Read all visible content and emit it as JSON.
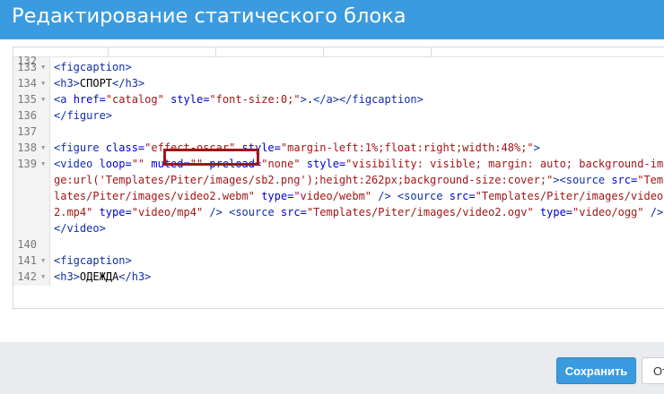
{
  "dialog": {
    "title": "Редактирование статического блока"
  },
  "editor": {
    "lines": [
      {
        "num": "133",
        "fold": true,
        "parts": [
          [
            "t",
            "<figcaption>"
          ]
        ]
      },
      {
        "num": "134",
        "fold": true,
        "parts": [
          [
            "t",
            "<h3>"
          ],
          [
            "x",
            "СПОРТ"
          ],
          [
            "t",
            "</h3>"
          ]
        ]
      },
      {
        "num": "135",
        "fold": true,
        "parts": [
          [
            "t",
            "<a "
          ],
          [
            "a",
            "href="
          ],
          [
            "s",
            "\"catalog\""
          ],
          [
            "a",
            " style="
          ],
          [
            "s",
            "\"font-size:0;\""
          ],
          [
            "t",
            ">"
          ],
          [
            "x",
            "."
          ],
          [
            "t",
            "</a></figcaption>"
          ]
        ]
      },
      {
        "num": "136",
        "fold": false,
        "parts": [
          [
            "t",
            "</figure>"
          ]
        ]
      },
      {
        "num": "137",
        "fold": false,
        "parts": []
      },
      {
        "num": "138",
        "fold": true,
        "parts": [
          [
            "t",
            "<figure "
          ],
          [
            "a",
            "class="
          ],
          [
            "s",
            "\"effect-oscar\""
          ],
          [
            "a",
            " style="
          ],
          [
            "s",
            "\"margin-left:1%;float:right;width:48%;\""
          ],
          [
            "t",
            ">"
          ]
        ]
      },
      {
        "num": "139",
        "fold": true,
        "parts": [
          [
            "t",
            "<video "
          ],
          [
            "a",
            "loop="
          ],
          [
            "s",
            "\"\""
          ],
          [
            "a",
            " muted="
          ],
          [
            "s",
            "\"\""
          ],
          [
            "x",
            " "
          ],
          [
            "a",
            "preload="
          ],
          [
            "s",
            "\"none\""
          ],
          [
            "a",
            " style="
          ],
          [
            "s",
            "\"visibility: visible; margin: auto; background-ima"
          ]
        ]
      },
      {
        "num": "",
        "fold": false,
        "parts": [
          [
            "s",
            "ge:url('Templates/Piter/images/sb2.png');height:262px;background-size:cover;\""
          ],
          [
            "t",
            "><source "
          ],
          [
            "a",
            "src="
          ],
          [
            "s",
            "\"Templ"
          ]
        ]
      },
      {
        "num": "",
        "fold": false,
        "parts": [
          [
            "s",
            "lates/Piter/images/video2.webm\""
          ],
          [
            "a",
            " type="
          ],
          [
            "s",
            "\"video/webm\""
          ],
          [
            "t",
            " /> <source "
          ],
          [
            "a",
            "src="
          ],
          [
            "s",
            "\"Templates/Piter/images/video"
          ]
        ]
      },
      {
        "num": "",
        "fold": false,
        "parts": [
          [
            "s",
            "2.mp4\""
          ],
          [
            "a",
            " type="
          ],
          [
            "s",
            "\"video/mp4\""
          ],
          [
            "t",
            " /> <source "
          ],
          [
            "a",
            "src="
          ],
          [
            "s",
            "\"Templates/Piter/images/video2.ogv\""
          ],
          [
            "a",
            " type="
          ],
          [
            "s",
            "\"video/ogg\""
          ],
          [
            "t",
            " />"
          ]
        ]
      },
      {
        "num": "",
        "fold": false,
        "parts": [
          [
            "t",
            "</video>"
          ]
        ]
      },
      {
        "num": "140",
        "fold": false,
        "parts": []
      },
      {
        "num": "141",
        "fold": true,
        "parts": [
          [
            "t",
            "<figcaption>"
          ]
        ]
      },
      {
        "num": "142",
        "fold": true,
        "parts": [
          [
            "t",
            "<h3>"
          ],
          [
            "x",
            "ОДЕЖДА"
          ],
          [
            "t",
            "</h3>"
          ]
        ]
      }
    ],
    "top_line": "132"
  },
  "buttons": {
    "save_label": "Сохранить",
    "cancel_label": "От"
  },
  "colors": {
    "accent": "#3a9be0",
    "highlight": "#a01515"
  }
}
